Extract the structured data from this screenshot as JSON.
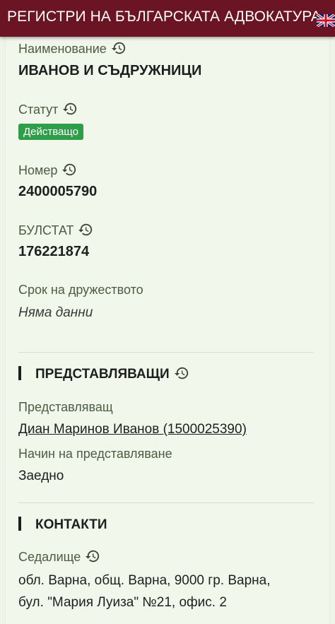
{
  "header": {
    "title": "РЕГИСТРИ НА БЪЛГАРСКАТА АДВОКАТУРА",
    "language_icon": "uk-flag-icon",
    "brand_color": "#6b1524"
  },
  "fields": {
    "name": {
      "label": "Наименование",
      "value": "ИВАНОВ И СЪДРУЖНИЦИ"
    },
    "status": {
      "label": "Статут",
      "value": "Действащо",
      "badge_color": "#2e9e48"
    },
    "number": {
      "label": "Номер",
      "value": "2400005790"
    },
    "bulstat": {
      "label": "БУЛСТАТ",
      "value": "176221874"
    },
    "term": {
      "label": "Срок на дружеството",
      "value": "Няма данни"
    }
  },
  "representatives": {
    "heading": "ПРЕДСТАВЛЯВАЩИ",
    "rep_label": "Представляващ",
    "rep_value": "Диан Маринов Иванов (1500025390)",
    "method_label": "Начин на представляване",
    "method_value": "Заедно"
  },
  "contacts": {
    "heading": "КОНТАКТИ",
    "seat_label": "Седалище",
    "seat_line1": "обл. Варна, общ. Варна, 9000 гр. Варна,",
    "seat_line2": "бул. \"Мария Луиза\" №21, офис. 2"
  },
  "icons": {
    "history": "history-icon"
  }
}
